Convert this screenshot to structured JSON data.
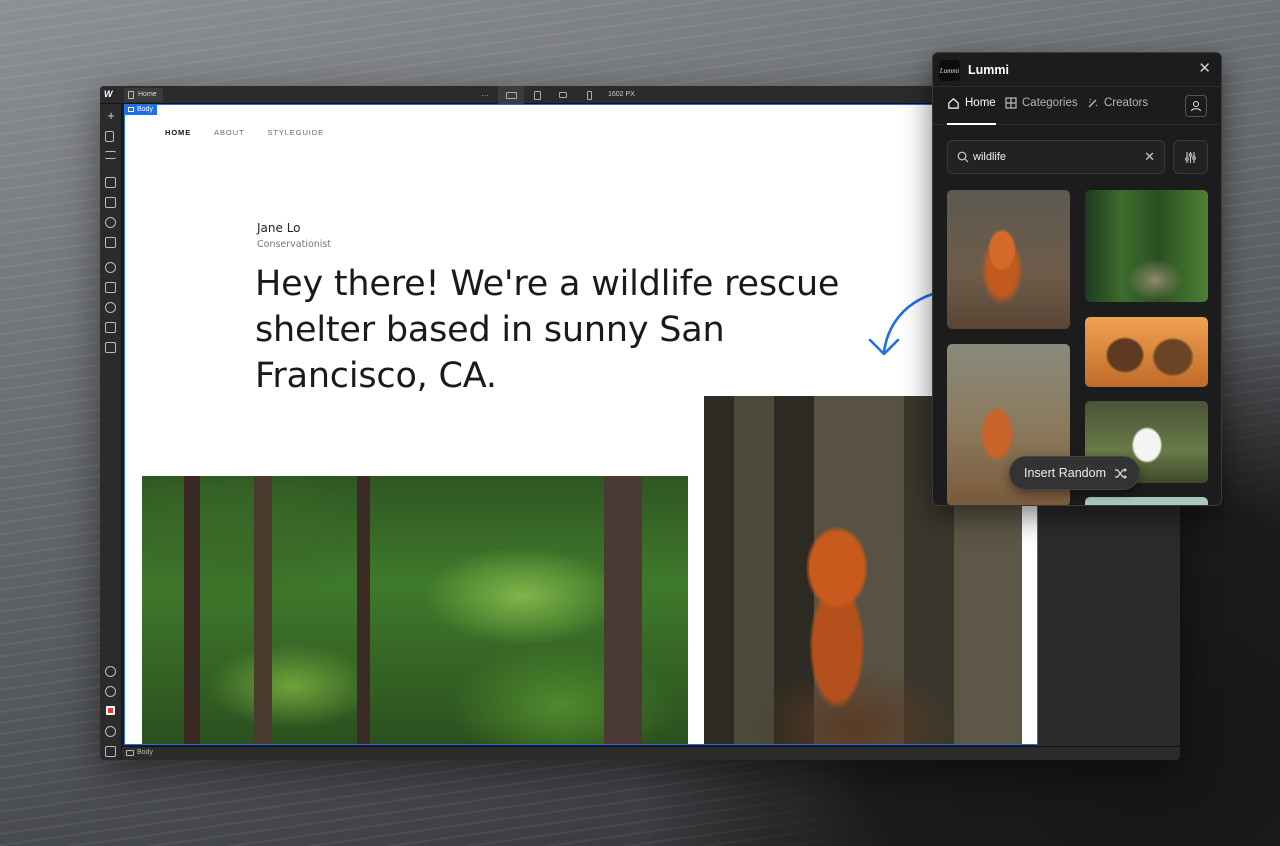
{
  "editor": {
    "page_tab": "Home",
    "canvas_width": "1602 PX",
    "more_dots": "···",
    "body_tag": "Body",
    "breadcrumb": "Body"
  },
  "site": {
    "nav": [
      "HOME",
      "ABOUT",
      "STYLEGUIDE"
    ],
    "author": "Jane Lo",
    "role": "Conservationist",
    "headline": "Hey there! We're a wildlife rescue shelter based in sunny San Francisco, CA."
  },
  "lummi": {
    "logo_text": "Lummi",
    "title": "Lummi",
    "tabs": [
      {
        "label": "Home",
        "icon": "home-icon"
      },
      {
        "label": "Categories",
        "icon": "grid-icon"
      },
      {
        "label": "Creators",
        "icon": "magic-wand-icon"
      }
    ],
    "search_value": "wildlife",
    "insert_label": "Insert Random"
  },
  "colors": {
    "accent": "#1f6feb",
    "panel_bg": "#1c1c1c"
  }
}
